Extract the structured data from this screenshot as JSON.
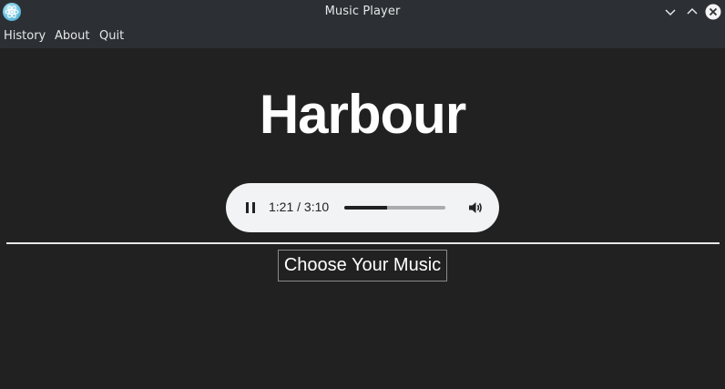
{
  "window": {
    "title": "Music Player",
    "icon": "app-atom-icon"
  },
  "menu": {
    "items": [
      "History",
      "About",
      "Quit"
    ]
  },
  "main": {
    "song_title": "Harbour",
    "player": {
      "state": "playing",
      "time_text": "1:21 / 3:10",
      "progress_fraction": 0.426,
      "volume_icon": "volume-icon",
      "play_pause_icon": "pause-icon"
    },
    "choose_button_label": "Choose Your Music"
  },
  "colors": {
    "titlebar_bg": "#2c3034",
    "content_bg": "#212121",
    "player_bg": "#f1f3f4",
    "text_primary": "#ffffff"
  }
}
